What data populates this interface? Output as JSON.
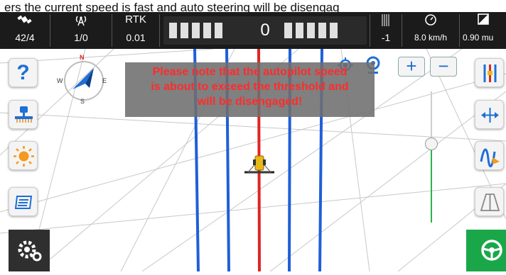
{
  "caption": "ers the current speed is fast and auto steering will be disengag",
  "status_bar": {
    "satellites": "42/4",
    "radio": "1/0",
    "rtk_label": "RTK",
    "rtk_value": "0.01",
    "lightbar_offset": "0",
    "signal_value": "-1",
    "speed": "8.0 km/h",
    "width": "0.90 mu"
  },
  "warning": {
    "line1": "Please note that the autopilot speed",
    "line2": "is about to exceed the threshold and",
    "line3": "will be disengaged!"
  },
  "compass": {
    "north": "N",
    "south": "S",
    "east": "E",
    "west": "W"
  },
  "zoom": {
    "in_label": "+",
    "out_label": "−"
  },
  "icons": {
    "help": "help-icon",
    "implement": "implement-icon",
    "brightness": "brightness-icon",
    "layers": "layers-icon",
    "settings": "settings-icon",
    "guidance": "guidance-lines-icon",
    "shift": "shift-line-icon",
    "curve": "curve-line-icon",
    "perspective": "perspective-view-icon",
    "steering": "steering-wheel-icon"
  },
  "colors": {
    "guidance_blue": "#1f5fd8",
    "guidance_red": "#e02424",
    "warning_text": "#ff2b2b",
    "engage_green": "#1aa74a",
    "topbar": "#1b1b1b"
  }
}
